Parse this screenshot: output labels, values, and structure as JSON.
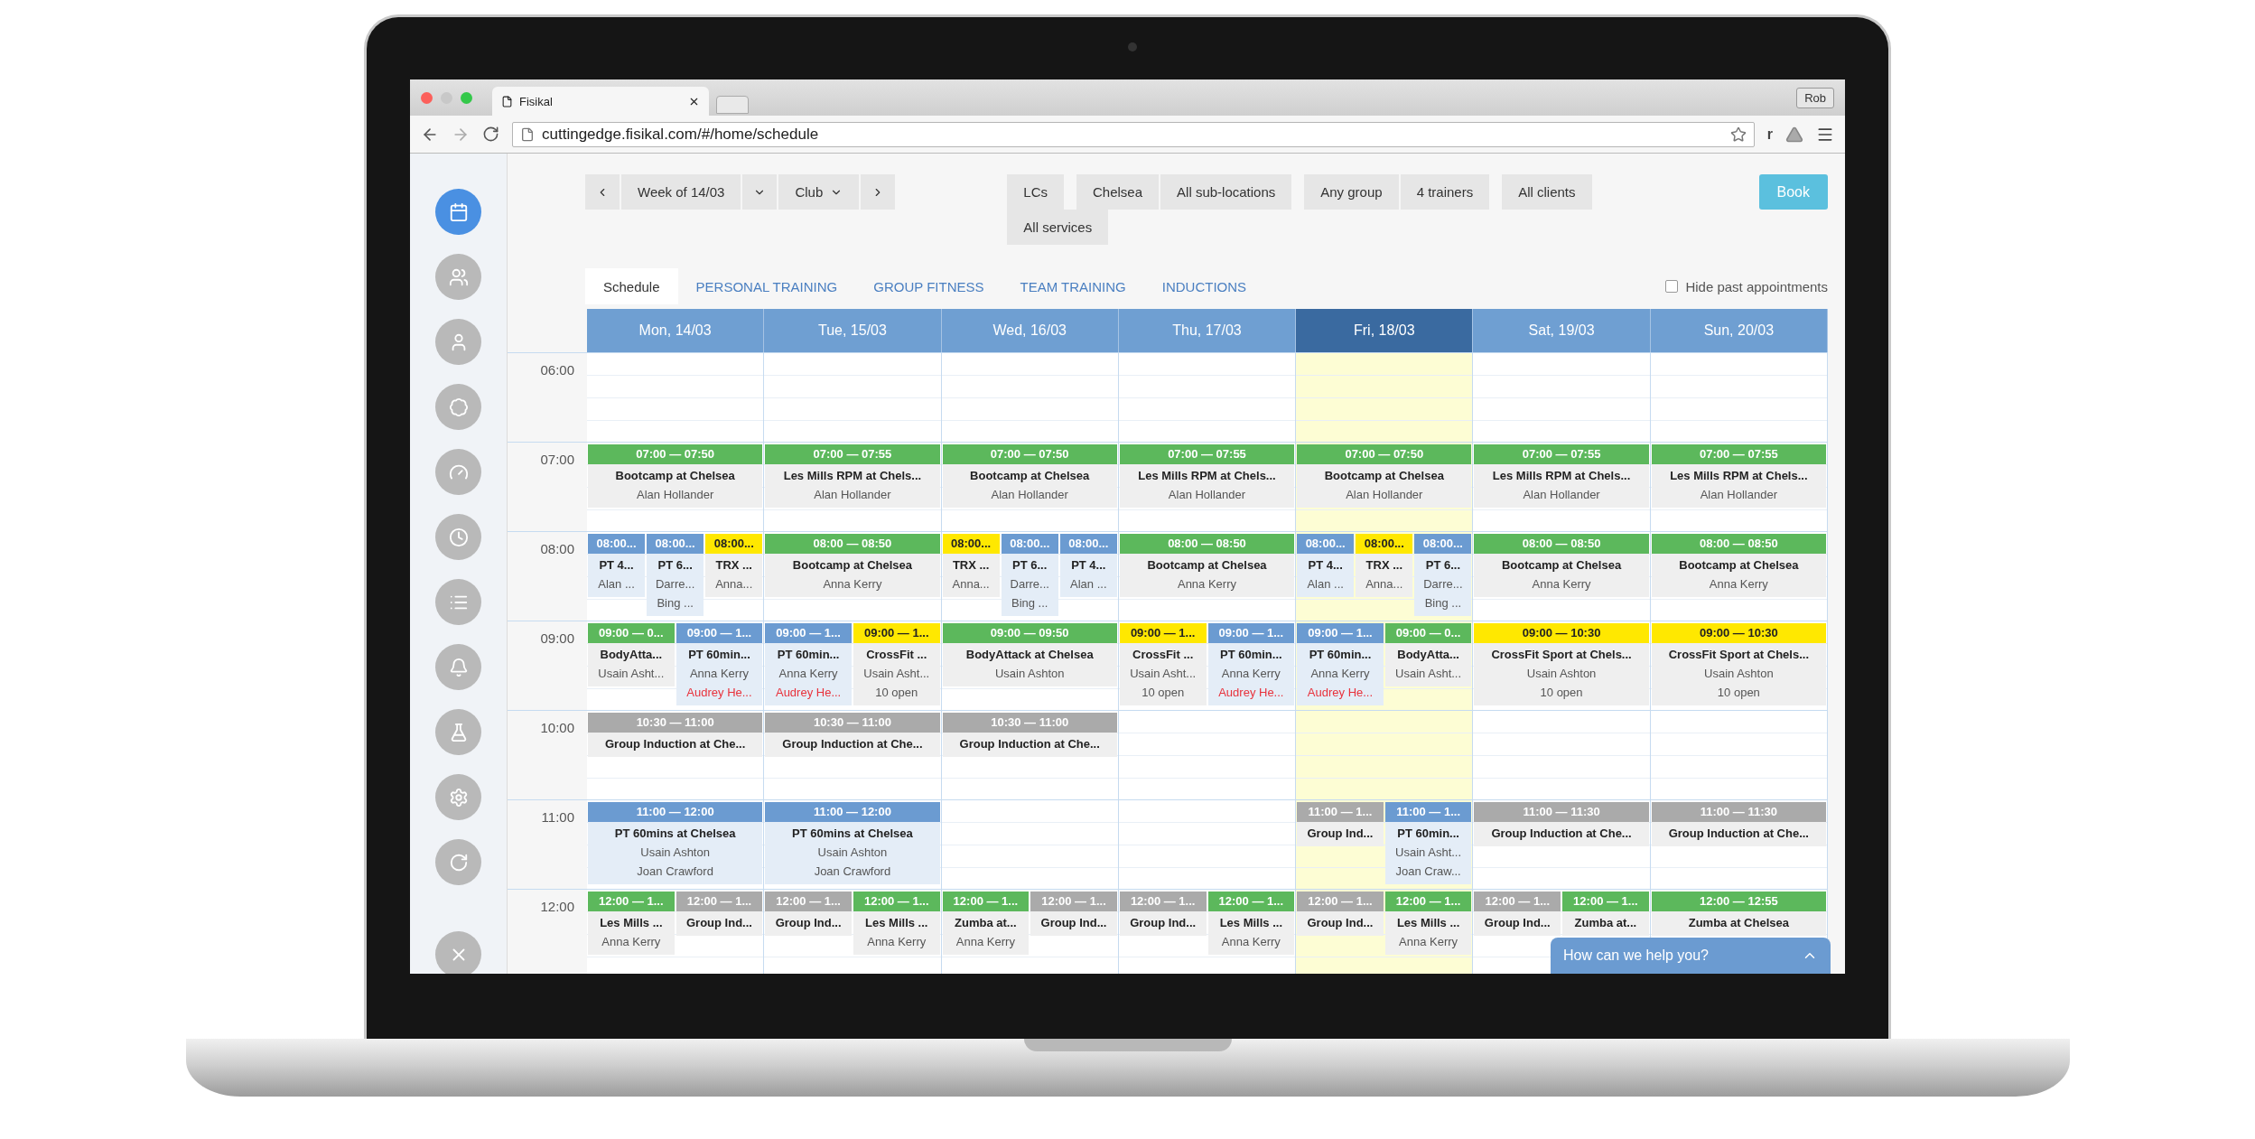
{
  "browser": {
    "tab_title": "Fisikal",
    "url": "cuttingedge.fisikal.com/#/home/schedule",
    "profile": "Rob",
    "extension": "r"
  },
  "sidebar": {
    "items": [
      {
        "selected": true
      },
      {
        "selected": false
      },
      {
        "selected": false
      },
      {
        "selected": false
      },
      {
        "selected": false
      },
      {
        "selected": false
      },
      {
        "selected": false
      },
      {
        "selected": false
      },
      {
        "selected": false
      },
      {
        "selected": false
      },
      {
        "selected": false
      }
    ]
  },
  "toolbar": {
    "week": "Week of 14/03",
    "club": "Club",
    "filter_groups": [
      {
        "items": [
          "LCs"
        ]
      },
      {
        "items": [
          "Chelsea",
          "All sub-locations"
        ]
      },
      {
        "items": [
          "Any group",
          "4 trainers"
        ]
      },
      {
        "items": [
          "All clients"
        ]
      },
      {
        "items": [
          "All services"
        ]
      }
    ],
    "book": "Book"
  },
  "tabs": [
    {
      "label": "Schedule",
      "selected": true
    },
    {
      "label": "PERSONAL TRAINING",
      "selected": false
    },
    {
      "label": "GROUP FITNESS",
      "selected": false
    },
    {
      "label": "TEAM TRAINING",
      "selected": false
    },
    {
      "label": "INDUCTIONS",
      "selected": false
    }
  ],
  "hide_past": {
    "label": "Hide past appointments",
    "checked": false
  },
  "schedule": {
    "days": [
      {
        "label": "Mon, 14/03",
        "selected": false
      },
      {
        "label": "Tue, 15/03",
        "selected": false
      },
      {
        "label": "Wed, 16/03",
        "selected": false
      },
      {
        "label": "Thu, 17/03",
        "selected": false
      },
      {
        "label": "Fri, 18/03",
        "selected": true
      },
      {
        "label": "Sat, 19/03",
        "selected": false
      },
      {
        "label": "Sun, 20/03",
        "selected": false
      }
    ],
    "hours": [
      {
        "label": "06:00",
        "cells": [
          {},
          {},
          {},
          {},
          {},
          {},
          {}
        ]
      },
      {
        "label": "07:00",
        "cells": [
          {
            "events": [
              {
                "time": "07:00 — 07:50",
                "color": "#5cb85c",
                "kind": "class",
                "title": "Bootcamp at Chelsea",
                "lines": [
                  {
                    "text": "Alan Hollander"
                  }
                ]
              }
            ]
          },
          {
            "events": [
              {
                "time": "07:00 — 07:55",
                "color": "#5cb85c",
                "kind": "class",
                "title": "Les Mills RPM at Chels...",
                "lines": [
                  {
                    "text": "Alan Hollander"
                  }
                ]
              }
            ]
          },
          {
            "events": [
              {
                "time": "07:00 — 07:50",
                "color": "#5cb85c",
                "kind": "class",
                "title": "Bootcamp at Chelsea",
                "lines": [
                  {
                    "text": "Alan Hollander"
                  }
                ]
              }
            ]
          },
          {
            "events": [
              {
                "time": "07:00 — 07:55",
                "color": "#5cb85c",
                "kind": "class",
                "title": "Les Mills RPM at Chels...",
                "lines": [
                  {
                    "text": "Alan Hollander"
                  }
                ]
              }
            ]
          },
          {
            "events": [
              {
                "time": "07:00 — 07:50",
                "color": "#5cb85c",
                "kind": "class",
                "title": "Bootcamp at Chelsea",
                "lines": [
                  {
                    "text": "Alan Hollander"
                  }
                ]
              }
            ]
          },
          {
            "events": [
              {
                "time": "07:00 — 07:55",
                "color": "#5cb85c",
                "kind": "class",
                "title": "Les Mills RPM at Chels...",
                "lines": [
                  {
                    "text": "Alan Hollander"
                  }
                ]
              }
            ]
          },
          {
            "events": [
              {
                "time": "07:00 — 07:55",
                "color": "#5cb85c",
                "kind": "class",
                "title": "Les Mills RPM at Chels...",
                "lines": [
                  {
                    "text": "Alan Hollander"
                  }
                ]
              }
            ]
          }
        ]
      },
      {
        "label": "08:00",
        "cells": [
          {
            "events": [
              {
                "time": "08:00...",
                "color": "#6b9bd1",
                "kind": "appointment",
                "title": "PT 4...",
                "lines": [
                  {
                    "text": "Alan ..."
                  }
                ]
              },
              {
                "time": "08:00...",
                "color": "#6b9bd1",
                "kind": "appointment",
                "title": "PT 6...",
                "lines": [
                  {
                    "text": "Darre..."
                  },
                  {
                    "text": "Bing ..."
                  }
                ]
              },
              {
                "time": "08:00...",
                "color": "#ffe800",
                "kind": "class",
                "title": "TRX ...",
                "lines": [
                  {
                    "text": "Anna..."
                  }
                ]
              }
            ]
          },
          {
            "events": [
              {
                "time": "08:00 — 08:50",
                "color": "#5cb85c",
                "kind": "class",
                "title": "Bootcamp at Chelsea",
                "lines": [
                  {
                    "text": "Anna Kerry"
                  }
                ]
              }
            ]
          },
          {
            "events": [
              {
                "time": "08:00...",
                "color": "#ffe800",
                "kind": "class",
                "title": "TRX ...",
                "lines": [
                  {
                    "text": "Anna..."
                  }
                ]
              },
              {
                "time": "08:00...",
                "color": "#6b9bd1",
                "kind": "appointment",
                "title": "PT 6...",
                "lines": [
                  {
                    "text": "Darre..."
                  },
                  {
                    "text": "Bing ..."
                  }
                ]
              },
              {
                "time": "08:00...",
                "color": "#6b9bd1",
                "kind": "appointment",
                "title": "PT 4...",
                "lines": [
                  {
                    "text": "Alan ..."
                  }
                ]
              }
            ]
          },
          {
            "events": [
              {
                "time": "08:00 — 08:50",
                "color": "#5cb85c",
                "kind": "class",
                "title": "Bootcamp at Chelsea",
                "lines": [
                  {
                    "text": "Anna Kerry"
                  }
                ]
              }
            ]
          },
          {
            "events": [
              {
                "time": "08:00...",
                "color": "#6b9bd1",
                "kind": "appointment",
                "title": "PT 4...",
                "lines": [
                  {
                    "text": "Alan ..."
                  }
                ]
              },
              {
                "time": "08:00...",
                "color": "#ffe800",
                "kind": "class",
                "title": "TRX ...",
                "lines": [
                  {
                    "text": "Anna..."
                  }
                ]
              },
              {
                "time": "08:00...",
                "color": "#6b9bd1",
                "kind": "appointment",
                "title": "PT 6...",
                "lines": [
                  {
                    "text": "Darre..."
                  },
                  {
                    "text": "Bing ..."
                  }
                ]
              }
            ]
          },
          {
            "events": [
              {
                "time": "08:00 — 08:50",
                "color": "#5cb85c",
                "kind": "class",
                "title": "Bootcamp at Chelsea",
                "lines": [
                  {
                    "text": "Anna Kerry"
                  }
                ]
              }
            ]
          },
          {
            "events": [
              {
                "time": "08:00 — 08:50",
                "color": "#5cb85c",
                "kind": "class",
                "title": "Bootcamp at Chelsea",
                "lines": [
                  {
                    "text": "Anna Kerry"
                  }
                ]
              }
            ]
          }
        ]
      },
      {
        "label": "09:00",
        "cells": [
          {
            "events": [
              {
                "time": "09:00 — 0...",
                "color": "#5cb85c",
                "kind": "class",
                "title": "BodyAtta...",
                "lines": [
                  {
                    "text": "Usain Asht..."
                  }
                ]
              },
              {
                "time": "09:00 — 1...",
                "color": "#6b9bd1",
                "kind": "appointment",
                "title": "PT 60min...",
                "lines": [
                  {
                    "text": "Anna Kerry"
                  },
                  {
                    "text": "Audrey He...",
                    "color": "#e8323c"
                  }
                ]
              }
            ]
          },
          {
            "events": [
              {
                "time": "09:00 — 1...",
                "color": "#6b9bd1",
                "kind": "appointment",
                "title": "PT 60min...",
                "lines": [
                  {
                    "text": "Anna Kerry"
                  },
                  {
                    "text": "Audrey He...",
                    "color": "#e8323c"
                  }
                ]
              },
              {
                "time": "09:00 — 1...",
                "color": "#ffe800",
                "kind": "class",
                "title": "CrossFit ...",
                "lines": [
                  {
                    "text": "Usain Asht..."
                  },
                  {
                    "text": "10 open"
                  }
                ]
              }
            ]
          },
          {
            "events": [
              {
                "time": "09:00 — 09:50",
                "color": "#5cb85c",
                "kind": "class",
                "title": "BodyAttack at Chelsea",
                "lines": [
                  {
                    "text": "Usain Ashton"
                  }
                ]
              }
            ]
          },
          {
            "events": [
              {
                "time": "09:00 — 1...",
                "color": "#ffe800",
                "kind": "class",
                "title": "CrossFit ...",
                "lines": [
                  {
                    "text": "Usain Asht..."
                  },
                  {
                    "text": "10 open"
                  }
                ]
              },
              {
                "time": "09:00 — 1...",
                "color": "#6b9bd1",
                "kind": "appointment",
                "title": "PT 60min...",
                "lines": [
                  {
                    "text": "Anna Kerry"
                  },
                  {
                    "text": "Audrey He...",
                    "color": "#e8323c"
                  }
                ]
              }
            ]
          },
          {
            "events": [
              {
                "time": "09:00 — 1...",
                "color": "#6b9bd1",
                "kind": "appointment",
                "title": "PT 60min...",
                "lines": [
                  {
                    "text": "Anna Kerry"
                  },
                  {
                    "text": "Audrey He...",
                    "color": "#e8323c"
                  }
                ]
              },
              {
                "time": "09:00 — 0...",
                "color": "#5cb85c",
                "kind": "class",
                "title": "BodyAtta...",
                "lines": [
                  {
                    "text": "Usain Asht..."
                  }
                ]
              }
            ]
          },
          {
            "events": [
              {
                "time": "09:00 — 10:30",
                "color": "#ffe800",
                "kind": "class",
                "title": "CrossFit Sport at Chels...",
                "lines": [
                  {
                    "text": "Usain Ashton"
                  },
                  {
                    "text": "10 open"
                  }
                ]
              }
            ]
          },
          {
            "events": [
              {
                "time": "09:00 — 10:30",
                "color": "#ffe800",
                "kind": "class",
                "title": "CrossFit Sport at Chels...",
                "lines": [
                  {
                    "text": "Usain Ashton"
                  },
                  {
                    "text": "10 open"
                  }
                ]
              }
            ]
          }
        ]
      },
      {
        "label": "10:00",
        "cells": [
          {
            "events": [
              {
                "time": "10:30 — 11:00",
                "color": "#aaaaaa",
                "kind": "class",
                "title": "Group Induction at Che..."
              }
            ]
          },
          {
            "events": [
              {
                "time": "10:30 — 11:00",
                "color": "#aaaaaa",
                "kind": "class",
                "title": "Group Induction at Che..."
              }
            ]
          },
          {
            "events": [
              {
                "time": "10:30 — 11:00",
                "color": "#aaaaaa",
                "kind": "class",
                "title": "Group Induction at Che..."
              }
            ]
          },
          {},
          {},
          {},
          {}
        ]
      },
      {
        "label": "11:00",
        "cells": [
          {
            "events": [
              {
                "time": "11:00 — 12:00",
                "color": "#6b9bd1",
                "kind": "appointment",
                "title": "PT 60mins at Chelsea",
                "lines": [
                  {
                    "text": "Usain Ashton"
                  },
                  {
                    "text": "Joan Crawford"
                  }
                ]
              }
            ]
          },
          {
            "events": [
              {
                "time": "11:00 — 12:00",
                "color": "#6b9bd1",
                "kind": "appointment",
                "title": "PT 60mins at Chelsea",
                "lines": [
                  {
                    "text": "Usain Ashton"
                  },
                  {
                    "text": "Joan Crawford"
                  }
                ]
              }
            ]
          },
          {},
          {},
          {
            "events": [
              {
                "time": "11:00 — 1...",
                "color": "#aaaaaa",
                "kind": "class",
                "title": "Group Ind..."
              },
              {
                "time": "11:00 — 1...",
                "color": "#6b9bd1",
                "kind": "appointment",
                "title": "PT 60min...",
                "lines": [
                  {
                    "text": "Usain Asht..."
                  },
                  {
                    "text": "Joan Craw..."
                  }
                ]
              }
            ]
          },
          {
            "events": [
              {
                "time": "11:00 — 11:30",
                "color": "#aaaaaa",
                "kind": "class",
                "title": "Group Induction at Che..."
              }
            ]
          },
          {
            "events": [
              {
                "time": "11:00 — 11:30",
                "color": "#aaaaaa",
                "kind": "class",
                "title": "Group Induction at Che..."
              }
            ]
          }
        ]
      },
      {
        "label": "12:00",
        "cells": [
          {
            "events": [
              {
                "time": "12:00 — 1...",
                "color": "#5cb85c",
                "kind": "class",
                "title": "Les Mills ...",
                "lines": [
                  {
                    "text": "Anna Kerry"
                  }
                ]
              },
              {
                "time": "12:00 — 1...",
                "color": "#aaaaaa",
                "kind": "class",
                "title": "Group Ind..."
              }
            ]
          },
          {
            "events": [
              {
                "time": "12:00 — 1...",
                "color": "#aaaaaa",
                "kind": "class",
                "title": "Group Ind..."
              },
              {
                "time": "12:00 — 1...",
                "color": "#5cb85c",
                "kind": "class",
                "title": "Les Mills ...",
                "lines": [
                  {
                    "text": "Anna Kerry"
                  }
                ]
              }
            ]
          },
          {
            "events": [
              {
                "time": "12:00 — 1...",
                "color": "#5cb85c",
                "kind": "class",
                "title": "Zumba at...",
                "lines": [
                  {
                    "text": "Anna Kerry"
                  }
                ]
              },
              {
                "time": "12:00 — 1...",
                "color": "#aaaaaa",
                "kind": "class",
                "title": "Group Ind..."
              }
            ]
          },
          {
            "events": [
              {
                "time": "12:00 — 1...",
                "color": "#aaaaaa",
                "kind": "class",
                "title": "Group Ind..."
              },
              {
                "time": "12:00 — 1...",
                "color": "#5cb85c",
                "kind": "class",
                "title": "Les Mills ...",
                "lines": [
                  {
                    "text": "Anna Kerry"
                  }
                ]
              }
            ]
          },
          {
            "events": [
              {
                "time": "12:00 — 1...",
                "color": "#aaaaaa",
                "kind": "class",
                "title": "Group Ind..."
              },
              {
                "time": "12:00 — 1...",
                "color": "#5cb85c",
                "kind": "class",
                "title": "Les Mills ...",
                "lines": [
                  {
                    "text": "Anna Kerry"
                  }
                ]
              }
            ]
          },
          {
            "events": [
              {
                "time": "12:00 — 1...",
                "color": "#aaaaaa",
                "kind": "class",
                "title": "Group Ind..."
              },
              {
                "time": "12:00 — 1...",
                "color": "#5cb85c",
                "kind": "class",
                "title": "Zumba at..."
              }
            ]
          },
          {
            "events": [
              {
                "time": "12:00 — 12:55",
                "color": "#5cb85c",
                "kind": "class",
                "title": "Zumba at Chelsea"
              }
            ]
          }
        ]
      }
    ]
  },
  "chat": {
    "label": "How can we help you?"
  }
}
